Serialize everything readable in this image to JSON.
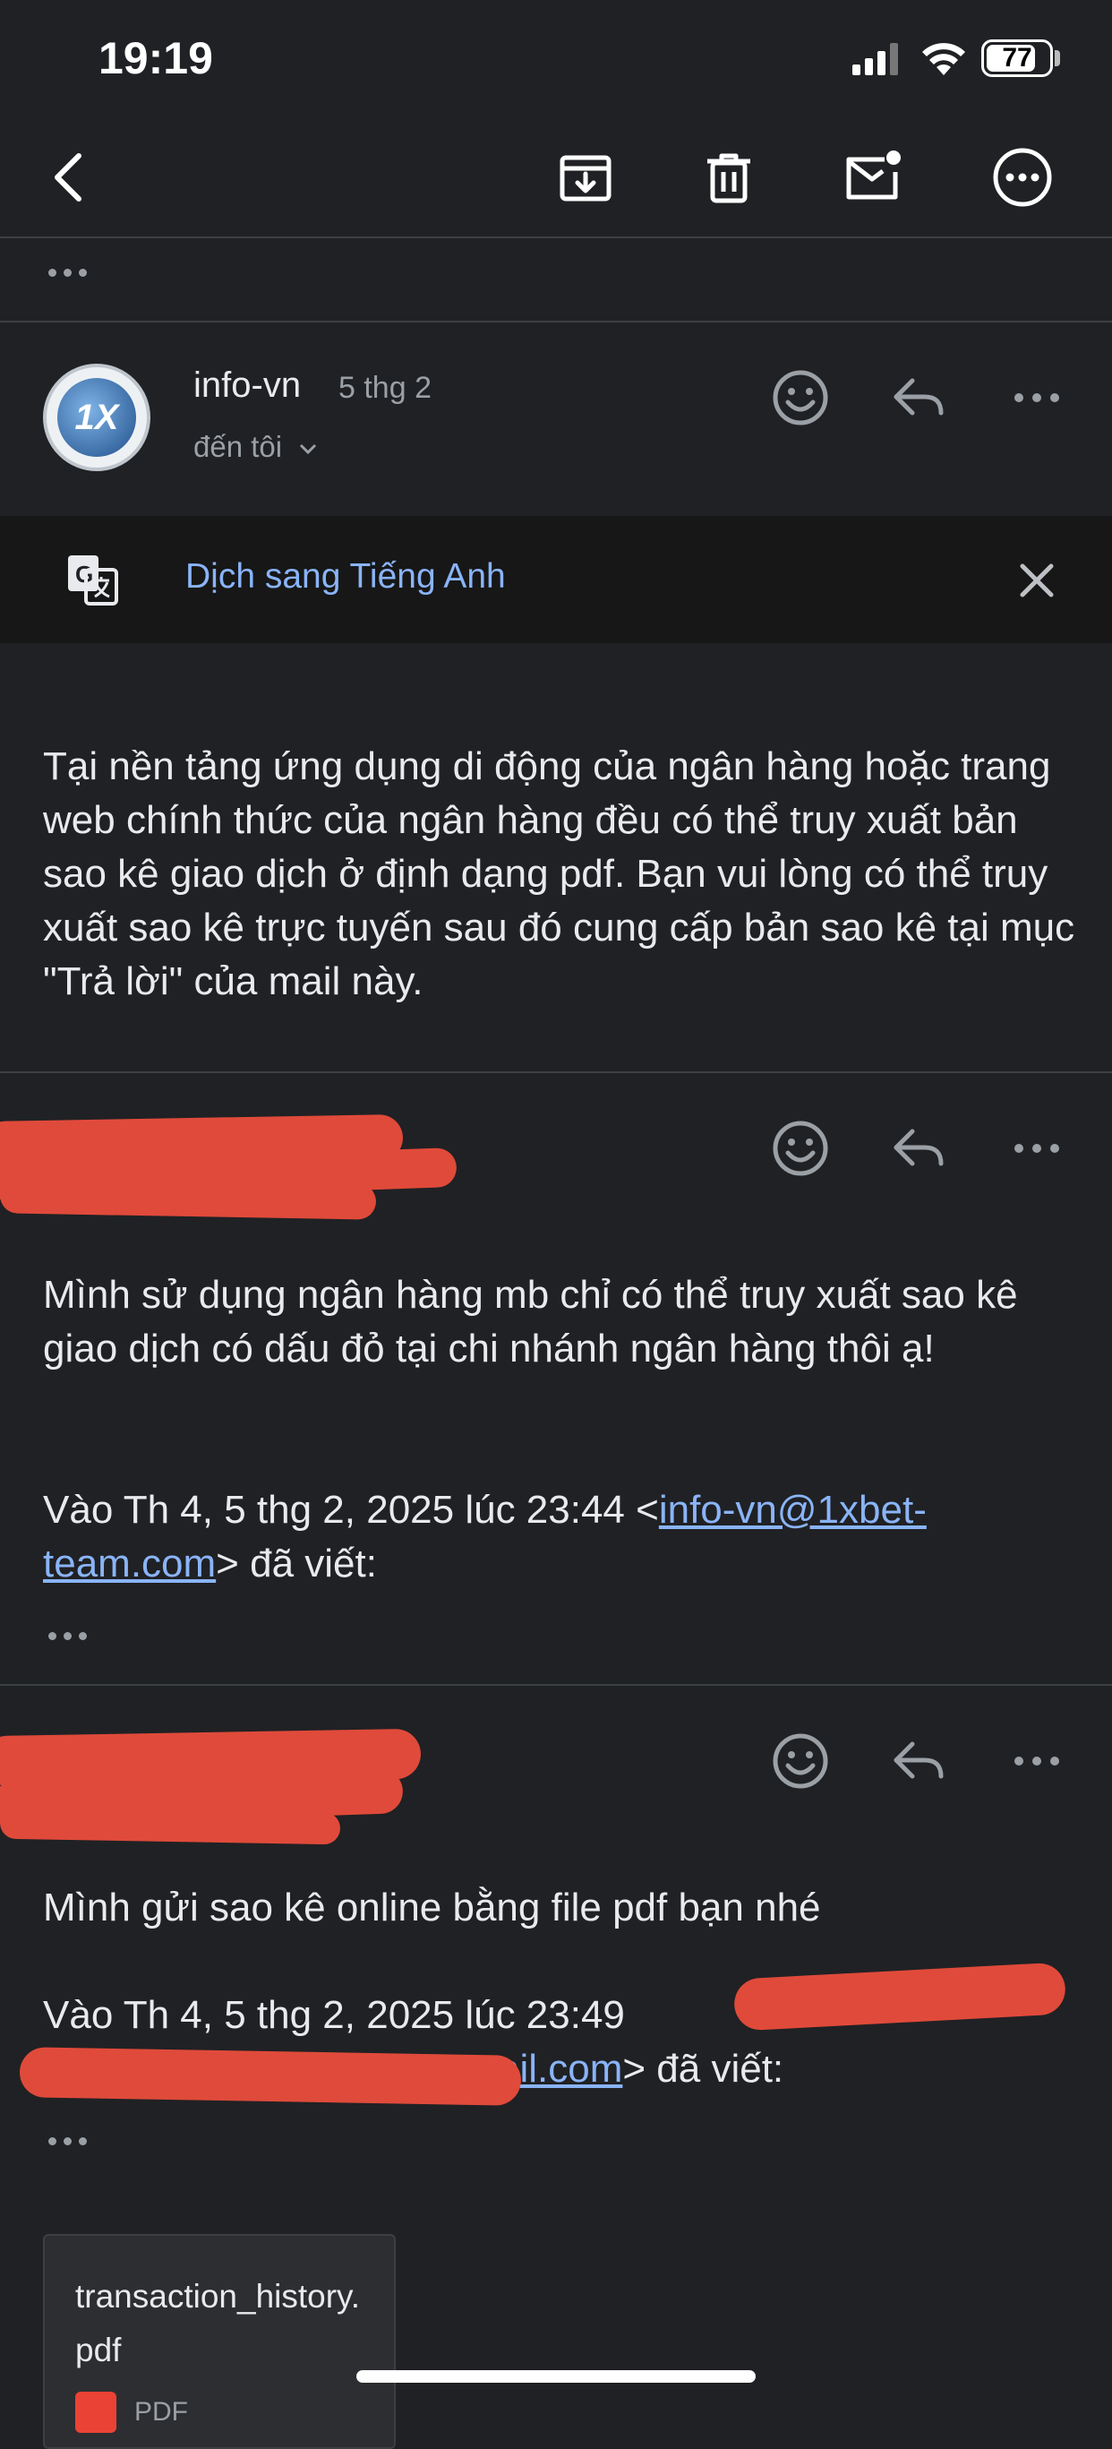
{
  "status_bar": {
    "time": "19:19",
    "battery": "77",
    "icons": [
      "signal-icon",
      "wifi-icon",
      "battery-icon"
    ]
  },
  "toolbar": {
    "icons": [
      "back-icon",
      "archive-icon",
      "trash-icon",
      "mark-unread-icon",
      "more-icon"
    ]
  },
  "thread": {
    "collapsed_indicator": "•••",
    "messages": [
      {
        "sender": "info-vn",
        "date": "5 thg 2",
        "recipient": "đến tôi",
        "avatar_text": "1X",
        "translate_label": "Dịch sang Tiếng Anh",
        "body": "Tại nền tảng ứng dụng di động của ngân hàng hoặc trang web chính thức của ngân hàng đều có thể truy xuất bản sao kê giao dịch ở định dạng pdf. Bạn vui lòng có thể truy xuất sao kê trực tuyến sau đó cung cấp bản sao kê tại mục \"Trả lời\" của mail này."
      },
      {
        "body": "Mình sử dụng ngân hàng mb chỉ có thể truy xuất sao kê giao dịch có dấu đỏ tại chi nhánh ngân hàng thôi ạ!",
        "quote_prefix": "Vào Th 4, 5 thg 2, 2025 lúc 23:44 <",
        "quote_link": "info-vn@1xbet-team.com",
        "quote_suffix": "> đã viết:",
        "quoted_indicator": "•••"
      },
      {
        "body": "Mình gửi sao kê online bằng file pdf bạn nhé",
        "quote_prefix": "Vào Th 4, 5 thg 2, 2025 lúc 23:49",
        "quote_link_visible": "ail.com",
        "quote_suffix": "> đã viết:",
        "quoted_indicator": "•••",
        "attachment": {
          "filename": "transaction_history.pdf",
          "type_label": "PDF"
        }
      }
    ]
  },
  "colors": {
    "background": "#202124",
    "link": "#8ab4f8",
    "redaction": "#e04a3a"
  }
}
